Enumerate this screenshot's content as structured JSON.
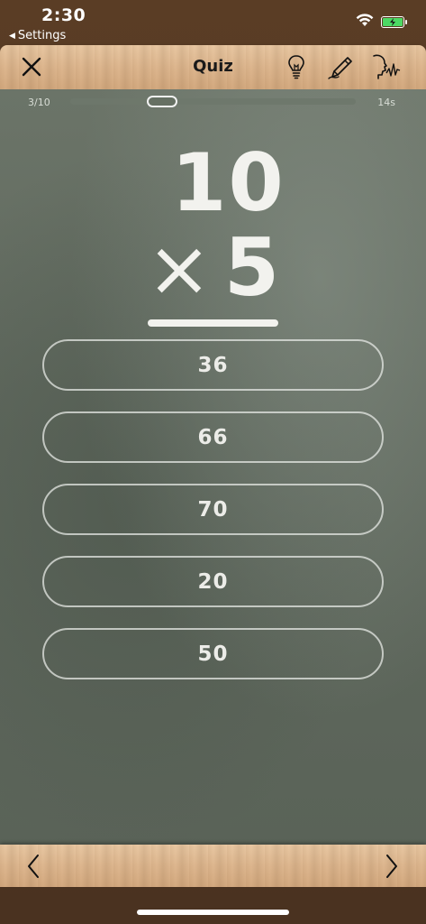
{
  "status": {
    "time": "2:30",
    "back_label": "Settings"
  },
  "toolbar": {
    "title": "Quiz"
  },
  "progress": {
    "counter": "3/10",
    "timer": "14s",
    "position": 0.3
  },
  "problem": {
    "top_operand": "10",
    "operator": "×",
    "bottom_operand": "5"
  },
  "answers": [
    {
      "label": "36"
    },
    {
      "label": "66"
    },
    {
      "label": "70"
    },
    {
      "label": "20"
    },
    {
      "label": "50"
    }
  ],
  "icons": {
    "close": "close-icon",
    "hint": "lightbulb-icon",
    "scratch": "pencil-icon",
    "speak": "speaking-head-icon",
    "prev": "chevron-left-icon",
    "next": "chevron-right-icon"
  },
  "colors": {
    "board": "#616a5f",
    "chalk": "#f2f2ee",
    "battery": "#4cd964",
    "wood": "#ddb68e"
  }
}
